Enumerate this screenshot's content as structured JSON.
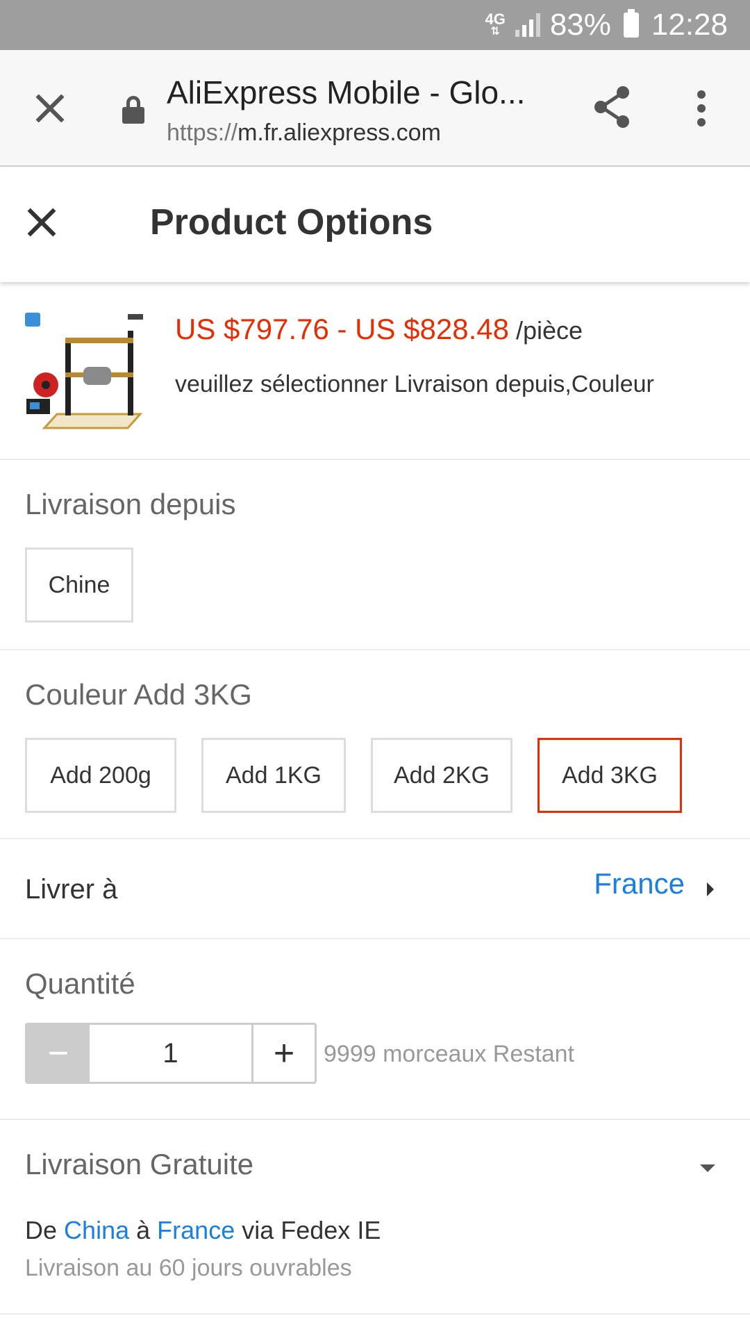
{
  "status_bar": {
    "network": "4G",
    "battery": "83%",
    "time": "12:28"
  },
  "browser": {
    "title": "AliExpress Mobile - Glo...",
    "url_scheme": "https://",
    "url_host": "m.fr.aliexpress.com"
  },
  "sheet": {
    "title": "Product Options"
  },
  "product": {
    "price": "US $797.76 - US $828.48",
    "unit": "/pièce",
    "notice": "veuillez sélectionner Livraison depuis,Couleur"
  },
  "ships_from": {
    "label": "Livraison depuis",
    "options": [
      "Chine"
    ]
  },
  "color": {
    "label": "Couleur Add 3KG",
    "options": [
      "Add 200g",
      "Add 1KG",
      "Add 2KG",
      "Add 3KG"
    ],
    "selected": "Add 3KG",
    "accent": "#e62e04"
  },
  "ship_to": {
    "label": "Livrer à",
    "value": "France",
    "link_color": "#1a7fe0"
  },
  "quantity": {
    "label": "Quantité",
    "minus": "−",
    "value": "1",
    "plus": "+",
    "stock": "9999 morceaux Restant"
  },
  "shipping": {
    "label": "Livraison Gratuite",
    "prefix": "De",
    "from": "China",
    "mid": "à",
    "to": "France",
    "carrier": "via Fedex IE",
    "eta": "Livraison au 60 jours ouvrables"
  }
}
